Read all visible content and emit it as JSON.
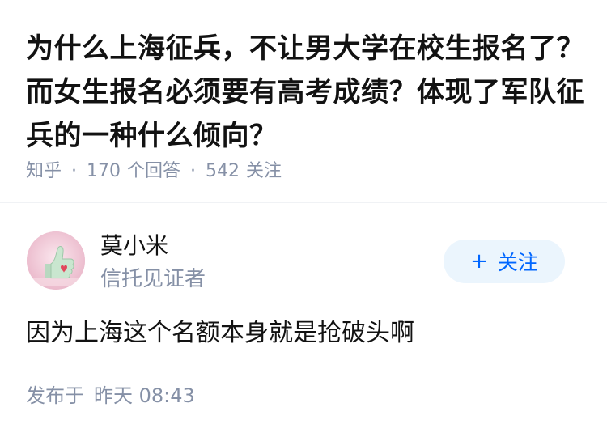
{
  "question": {
    "title": "为什么上海征兵，不让男大学在校生报名了？而女生报名必须要有高考成绩？体现了军队征兵的一种什么倾向？",
    "meta": {
      "source": "知乎",
      "separator": "·",
      "answer_count": "170",
      "answer_label": "个回答",
      "follower_count": "542",
      "follower_label": "关注"
    }
  },
  "author": {
    "avatar_icon": "thumbs-up-heart-avatar",
    "name": "莫小米",
    "headline": "信托见证者",
    "follow_label": "关注",
    "follow_icon": "+"
  },
  "answer": {
    "content": "因为上海这个名额本身就是抢破头啊",
    "published_label": "发布于",
    "published_time": "昨天 08:43"
  },
  "colors": {
    "title": "#121212",
    "meta": "#8590a6",
    "accent": "#0066ff",
    "follow_bg": "#ebf5fd"
  }
}
